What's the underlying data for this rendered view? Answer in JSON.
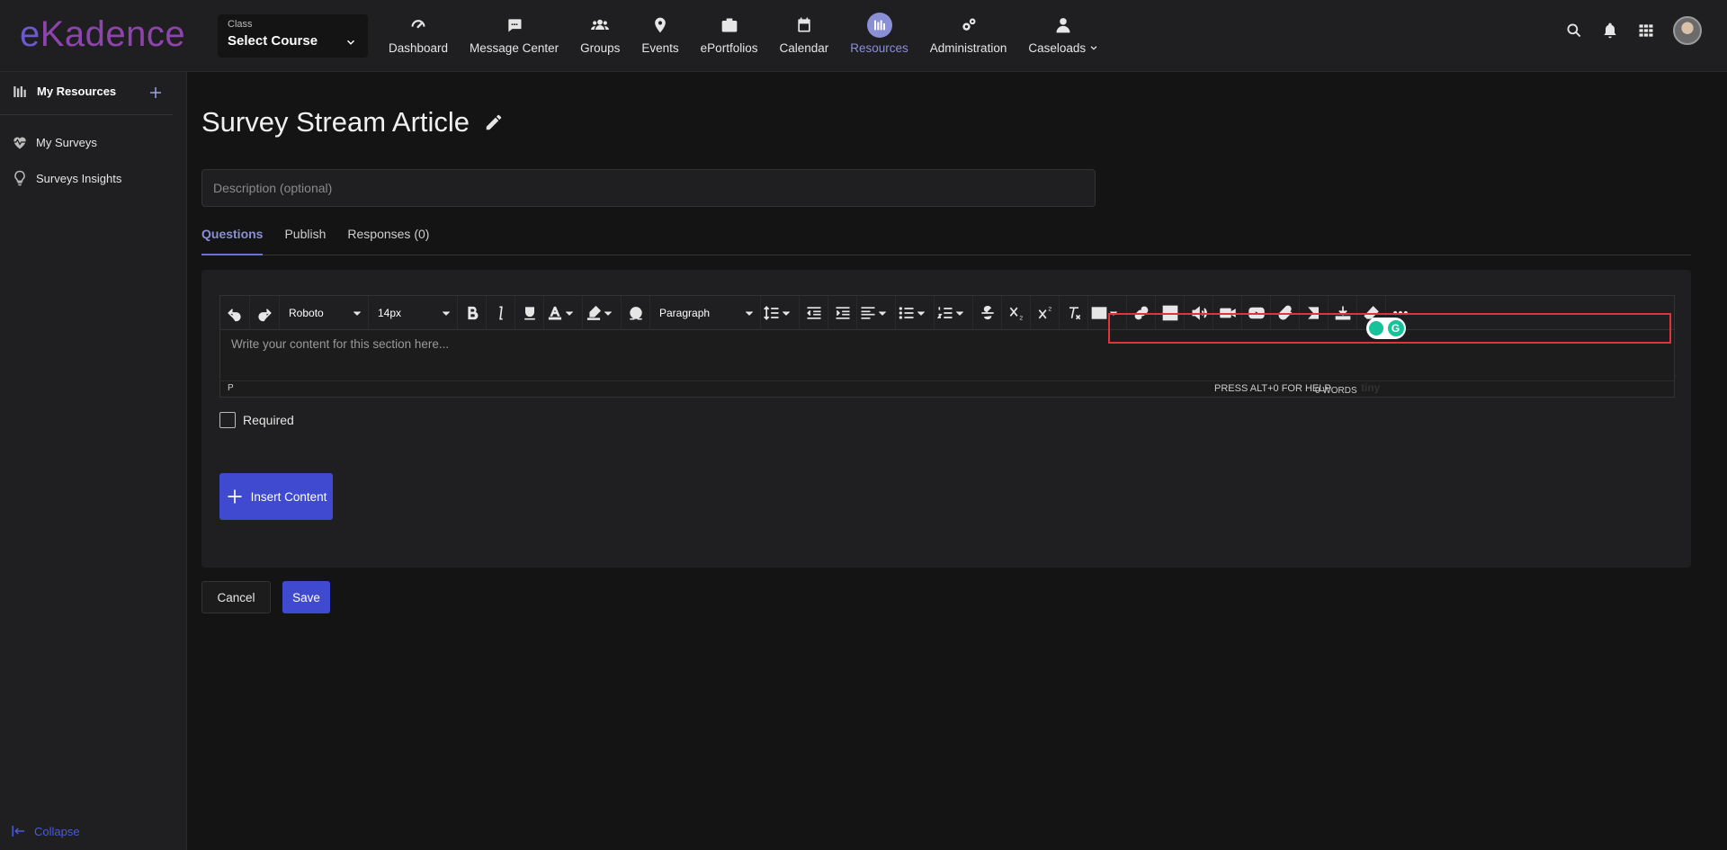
{
  "app": {
    "logo_text_e": "e",
    "logo_text_rest": "Kadence"
  },
  "class_select": {
    "label": "Class",
    "value": "Select Course"
  },
  "nav": [
    {
      "label": "Dashboard",
      "icon": "gauge-icon"
    },
    {
      "label": "Message Center",
      "icon": "chat-icon"
    },
    {
      "label": "Groups",
      "icon": "users-icon"
    },
    {
      "label": "Events",
      "icon": "map-pin-icon"
    },
    {
      "label": "ePortfolios",
      "icon": "briefcase-icon"
    },
    {
      "label": "Calendar",
      "icon": "calendar-icon"
    },
    {
      "label": "Resources",
      "icon": "library-icon",
      "active": true
    },
    {
      "label": "Administration",
      "icon": "gears-icon"
    },
    {
      "label": "Caseloads",
      "icon": "person-icon"
    }
  ],
  "sidebar": {
    "header": "My Resources",
    "items": [
      {
        "label": "My Surveys",
        "icon": "heartbeat-icon"
      },
      {
        "label": "Surveys Insights",
        "icon": "lightbulb-icon"
      }
    ],
    "collapse": "Collapse"
  },
  "page": {
    "title": "Survey Stream Article",
    "description_placeholder": "Description (optional)",
    "tabs": [
      "Questions",
      "Publish",
      "Responses (0)"
    ]
  },
  "editor": {
    "font": "Roboto",
    "size": "14px",
    "block": "Paragraph",
    "placeholder": "Write your content for this section here...",
    "status_path": "P",
    "help": "PRESS ALT+0 FOR HELP",
    "words": "0 WORDS",
    "brand": "tiny"
  },
  "question": {
    "required_label": "Required"
  },
  "buttons": {
    "insert": "Insert Content",
    "cancel": "Cancel",
    "save": "Save"
  },
  "colors": {
    "accent": "#3f4ad1",
    "active_nav": "#8a8fd6",
    "highlight": "#e0343a",
    "logo": "#8e44ad"
  }
}
